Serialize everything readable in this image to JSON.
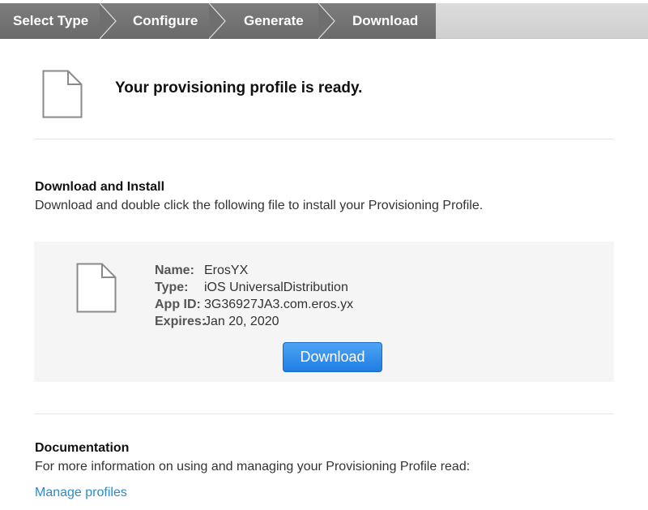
{
  "steps": [
    {
      "label": "Select Type"
    },
    {
      "label": "Configure"
    },
    {
      "label": "Generate"
    },
    {
      "label": "Download"
    }
  ],
  "hero": {
    "title": "Your provisioning profile is ready."
  },
  "download_install": {
    "title": "Download and Install",
    "description": "Download and double click the following file to install your Provisioning Profile."
  },
  "profile": {
    "fields": [
      {
        "key": "Name:",
        "value": "ErosYX"
      },
      {
        "key": "Type:",
        "value": "iOS UniversalDistribution"
      },
      {
        "key": "App ID:",
        "value": "3G36927JA3.com.eros.yx"
      },
      {
        "key": "Expires:",
        "value": "Jan 20, 2020"
      }
    ],
    "download_label": "Download"
  },
  "documentation": {
    "title": "Documentation",
    "description": "For more information on using and managing your Provisioning Profile read:",
    "link_label": "Manage profiles"
  },
  "colors": {
    "steps_bg": "#6e6e6e",
    "button": "#1f7ee2",
    "link": "#2d8ac6"
  }
}
